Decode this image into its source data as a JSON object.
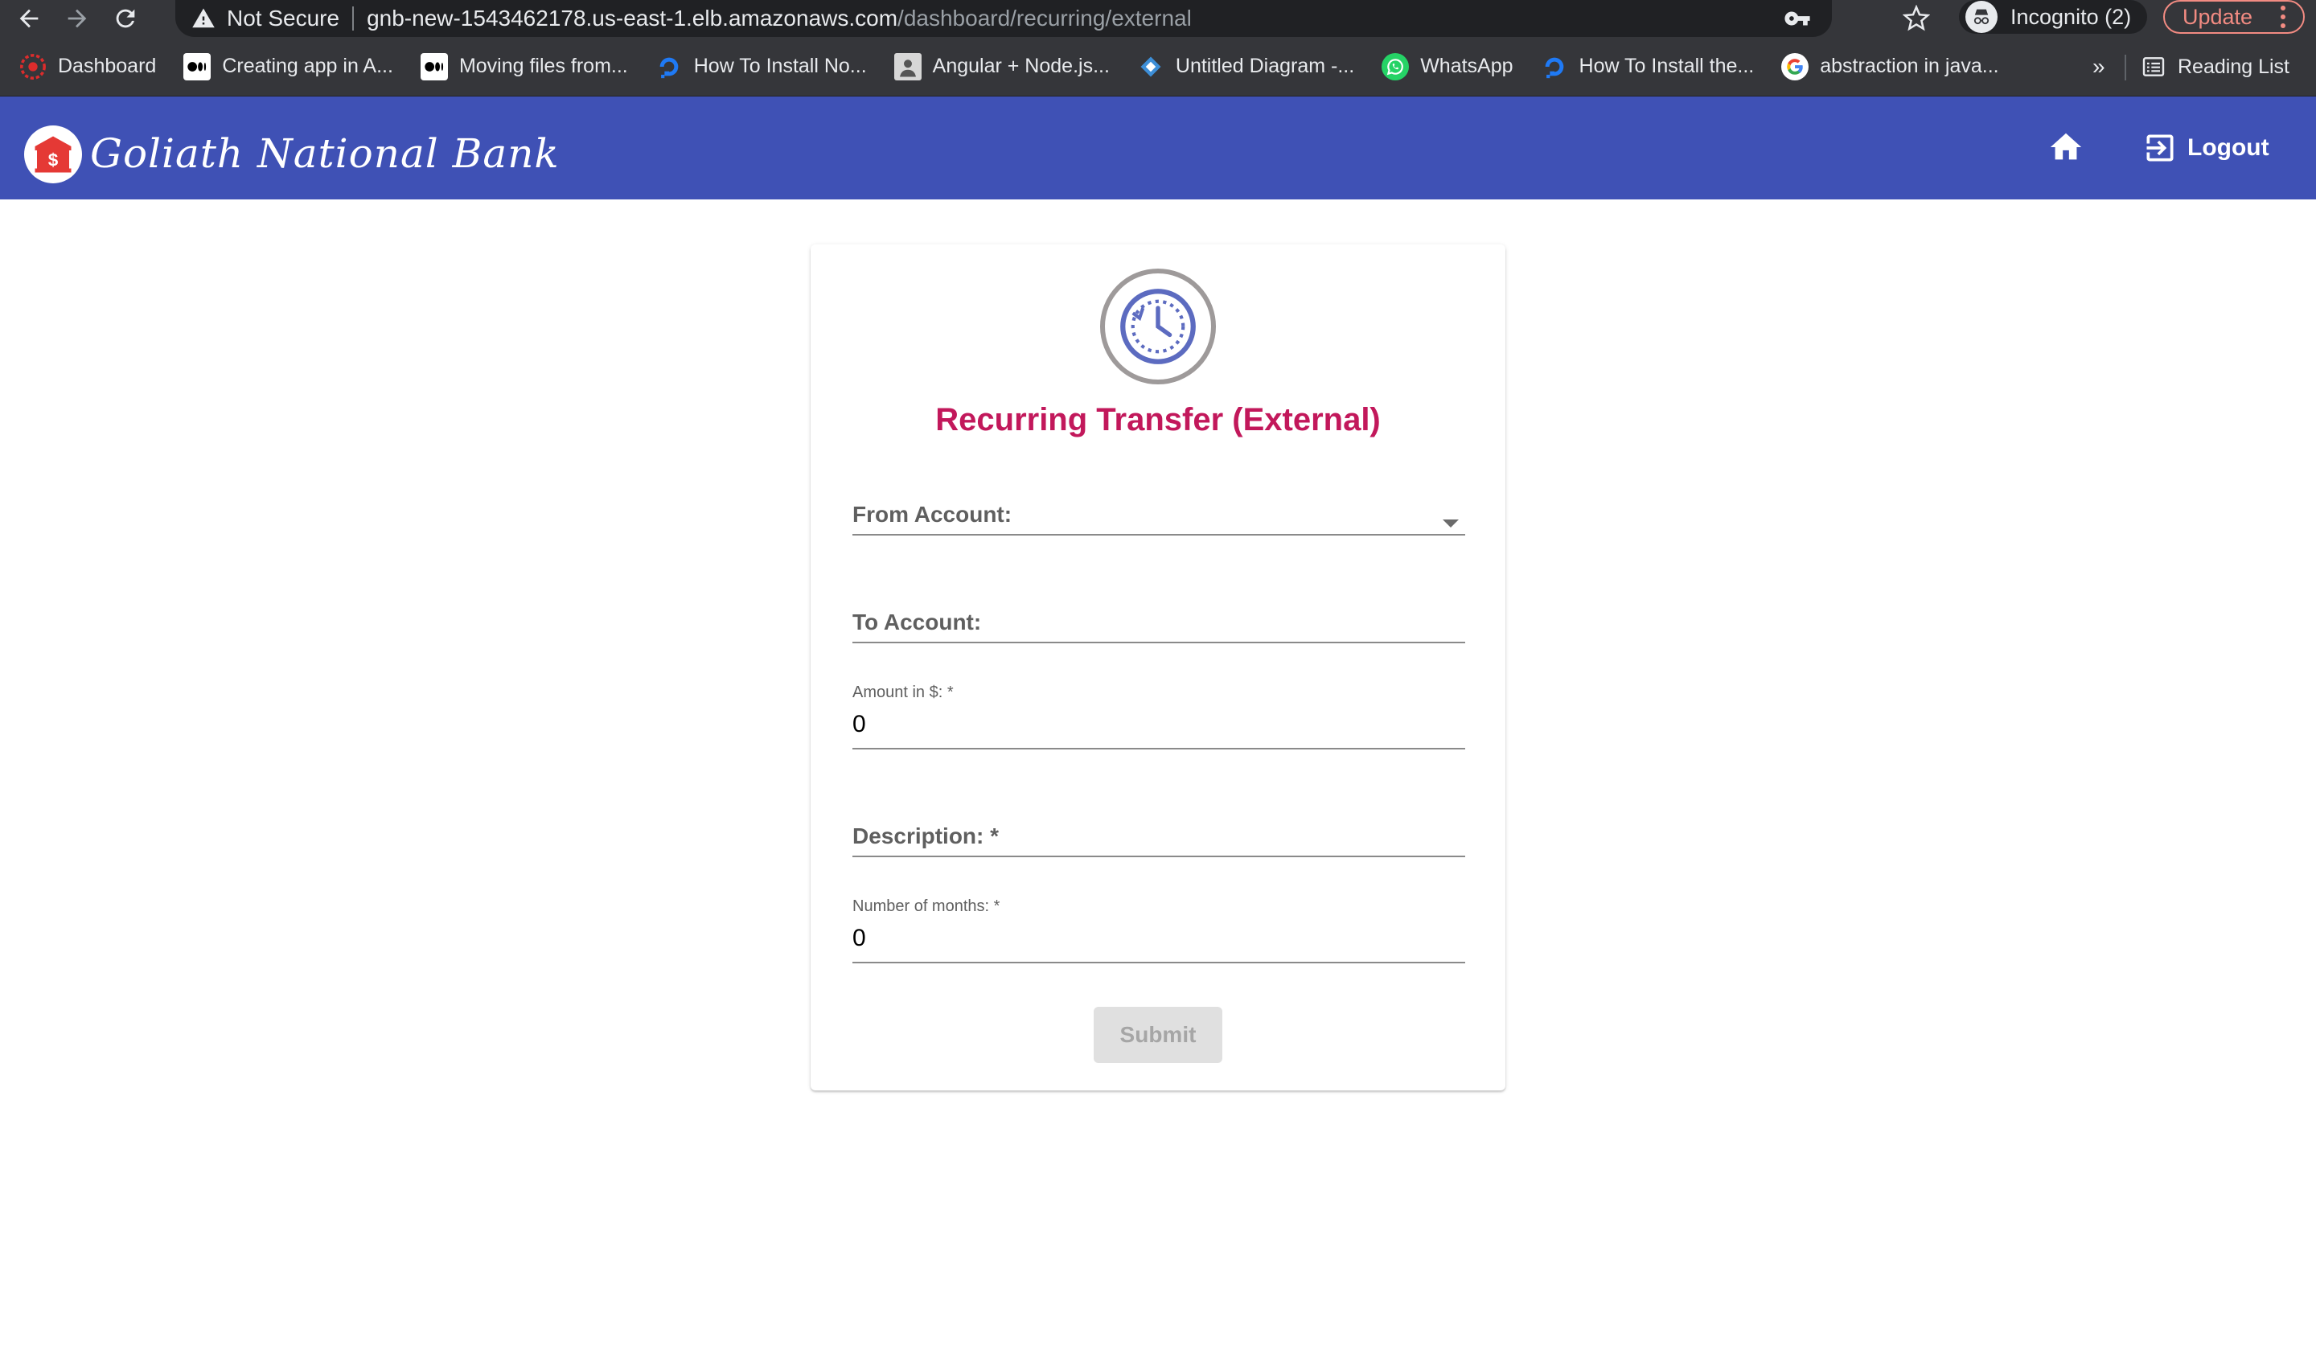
{
  "browser": {
    "security_status": "Not Secure",
    "url_host": "gnb-new-1543462178.us-east-1.elb.amazonaws.com",
    "url_path": "/dashboard/recurring/external",
    "profile_label": "Incognito (2)",
    "update_label": "Update",
    "more_bookmarks": "»",
    "reading_list": "Reading List",
    "bookmarks": [
      {
        "label": "Dashboard",
        "icon": "angular-icon"
      },
      {
        "label": "Creating app in A...",
        "icon": "medium-icon"
      },
      {
        "label": "Moving files from...",
        "icon": "medium-icon"
      },
      {
        "label": "How To Install No...",
        "icon": "digitalocean-icon"
      },
      {
        "label": "Angular + Node.js...",
        "icon": "avatar-icon"
      },
      {
        "label": "Untitled Diagram -...",
        "icon": "drawio-icon"
      },
      {
        "label": "WhatsApp",
        "icon": "whatsapp-icon"
      },
      {
        "label": "How To Install the...",
        "icon": "digitalocean-icon"
      },
      {
        "label": "abstraction in java...",
        "icon": "google-icon"
      }
    ]
  },
  "app": {
    "brand": "Goliath National Bank",
    "logout_label": "Logout",
    "colors": {
      "header": "#3f51b5",
      "title": "#c2185b"
    }
  },
  "form": {
    "title": "Recurring Transfer (External)",
    "from_account_label": "From Account:",
    "to_account_label": "To Account:",
    "amount_label": "Amount in $: *",
    "amount_value": "0",
    "description_label": "Description: *",
    "months_label": "Number of months: *",
    "months_value": "0",
    "submit_label": "Submit"
  }
}
